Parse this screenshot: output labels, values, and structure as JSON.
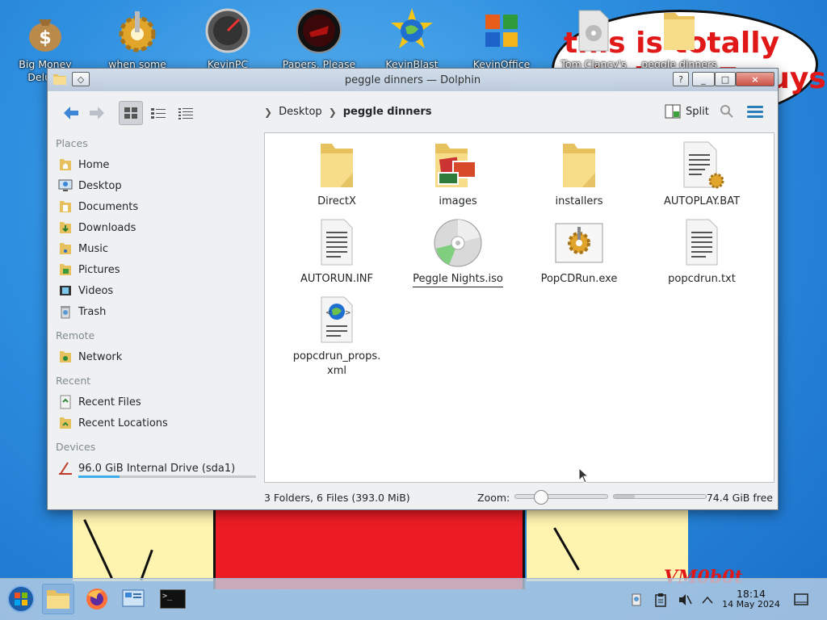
{
  "wallpaper": {
    "bubble_line1": "this is totally",
    "bubble_line2": "windows 7 guys",
    "watermark": "VM0b0t"
  },
  "desktop_icons": [
    {
      "label": "Big Money\nDeluxe"
    },
    {
      "label": "when some\nrussian runs a..."
    },
    {
      "label": "KevinPC\nOptimizer Ho..."
    },
    {
      "label": "Papers, Please"
    },
    {
      "label": "KevinBlast\nBrowser"
    },
    {
      "label": "KevinOffice\n2009"
    },
    {
      "label": "Tom Clancy's\nHAWX"
    },
    {
      "label": "peggle dinners"
    }
  ],
  "window": {
    "title": "peggle dinners — Dolphin",
    "buttons": {
      "help": "?",
      "minimize": "_",
      "maximize": "□",
      "close": "×"
    }
  },
  "toolbar": {
    "breadcrumb": [
      "Desktop",
      "peggle dinners"
    ],
    "split_label": "Split"
  },
  "sidebar": {
    "places_header": "Places",
    "places": [
      {
        "label": "Home",
        "icon": "home-icon"
      },
      {
        "label": "Desktop",
        "icon": "desktop-icon"
      },
      {
        "label": "Documents",
        "icon": "documents-icon"
      },
      {
        "label": "Downloads",
        "icon": "downloads-icon"
      },
      {
        "label": "Music",
        "icon": "music-icon"
      },
      {
        "label": "Pictures",
        "icon": "pictures-icon"
      },
      {
        "label": "Videos",
        "icon": "videos-icon"
      },
      {
        "label": "Trash",
        "icon": "trash-icon"
      }
    ],
    "remote_header": "Remote",
    "remote": [
      {
        "label": "Network",
        "icon": "network-icon"
      }
    ],
    "recent_header": "Recent",
    "recent": [
      {
        "label": "Recent Files",
        "icon": "recent-files-icon"
      },
      {
        "label": "Recent Locations",
        "icon": "recent-locations-icon"
      }
    ],
    "devices_header": "Devices",
    "devices": [
      {
        "label": "96.0 GiB Internal Drive (sda1)",
        "icon": "drive-icon",
        "usage_fraction": 0.23
      }
    ]
  },
  "files": [
    {
      "name": "DirectX",
      "type": "folder"
    },
    {
      "name": "images",
      "type": "folder-images"
    },
    {
      "name": "installers",
      "type": "folder"
    },
    {
      "name": "AUTOPLAY.BAT",
      "type": "script"
    },
    {
      "name": "AUTORUN.INF",
      "type": "text"
    },
    {
      "name": "Peggle Nights.iso",
      "type": "disc"
    },
    {
      "name": "PopCDRun.exe",
      "type": "exe"
    },
    {
      "name": "popcdrun.txt",
      "type": "text"
    },
    {
      "name": "popcdrun_props.\nxml",
      "type": "xml"
    }
  ],
  "status": {
    "summary": "3 Folders, 6 Files (393.0 MiB)",
    "zoom_label": "Zoom:",
    "zoom_fraction": 0.28,
    "free_space": "74.4 GiB free",
    "free_fraction": 0.23
  },
  "taskbar": {
    "time": "18:14",
    "date": "14 May 2024",
    "terminal_label": ">_"
  },
  "colors": {
    "accent": "#3daee9",
    "folder": "#f2d57e",
    "close": "#c9453a"
  }
}
